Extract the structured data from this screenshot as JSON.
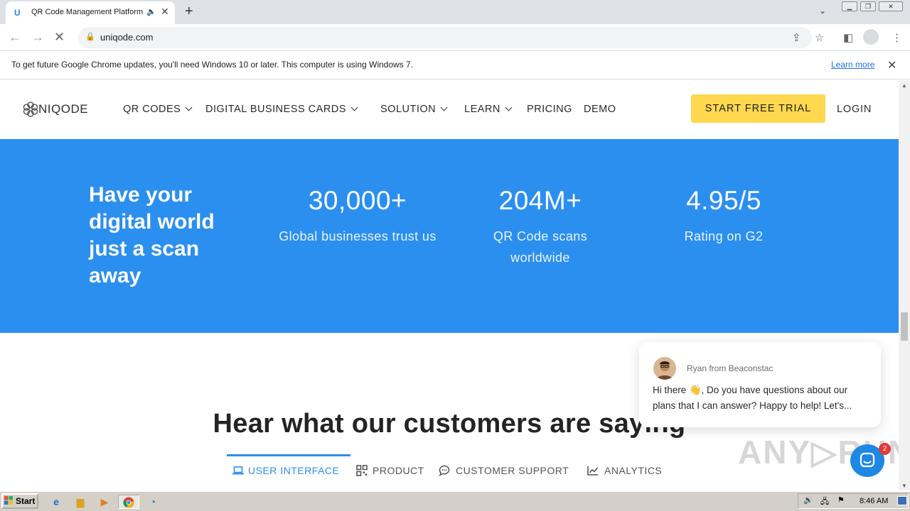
{
  "browser": {
    "tab": {
      "title": "QR Code Management Platform",
      "favicon": "U"
    },
    "url": "uniqode.com",
    "info_bar": {
      "message": "To get future Google Chrome updates, you'll need Windows 10 or later. This computer is using Windows 7.",
      "learn_more": "Learn more"
    }
  },
  "site": {
    "logo": "NIQODE",
    "nav": [
      {
        "label": "QR CODES",
        "dropdown": true
      },
      {
        "label": "DIGITAL BUSINESS CARDS",
        "dropdown": true
      },
      {
        "label": "SOLUTION",
        "dropdown": true
      },
      {
        "label": "LEARN",
        "dropdown": true
      },
      {
        "label": "PRICING",
        "dropdown": false
      },
      {
        "label": "DEMO",
        "dropdown": false
      }
    ],
    "cta": "START FREE TRIAL",
    "login": "LOGIN",
    "hero": {
      "headline": "Have your digital world just a scan away",
      "stats": [
        {
          "value": "30,000+",
          "label": "Global businesses trust us"
        },
        {
          "value": "204M+",
          "label": "QR Code scans worldwide"
        },
        {
          "value": "4.95/5",
          "label": "Rating on G2"
        }
      ]
    },
    "testimonials": {
      "title": "Hear what our customers are saying",
      "tabs": [
        {
          "label": "USER INTERFACE",
          "icon": "laptop-icon"
        },
        {
          "label": "PRODUCT",
          "icon": "qr-grid-icon"
        },
        {
          "label": "CUSTOMER SUPPORT",
          "icon": "chat-bubble-icon"
        },
        {
          "label": "ANALYTICS",
          "icon": "trend-chart-icon"
        }
      ]
    },
    "chat": {
      "sender": "Ryan from Beaconstac",
      "greeting": "Hi there",
      "message": "Do you have questions about our plans that I can answer? Happy to help! Let's...",
      "unread": "2"
    }
  },
  "taskbar": {
    "start": "Start",
    "time": "8:46 AM"
  },
  "colors": {
    "brand_blue": "#2b8ff0",
    "cta_yellow": "#ffd84f"
  }
}
